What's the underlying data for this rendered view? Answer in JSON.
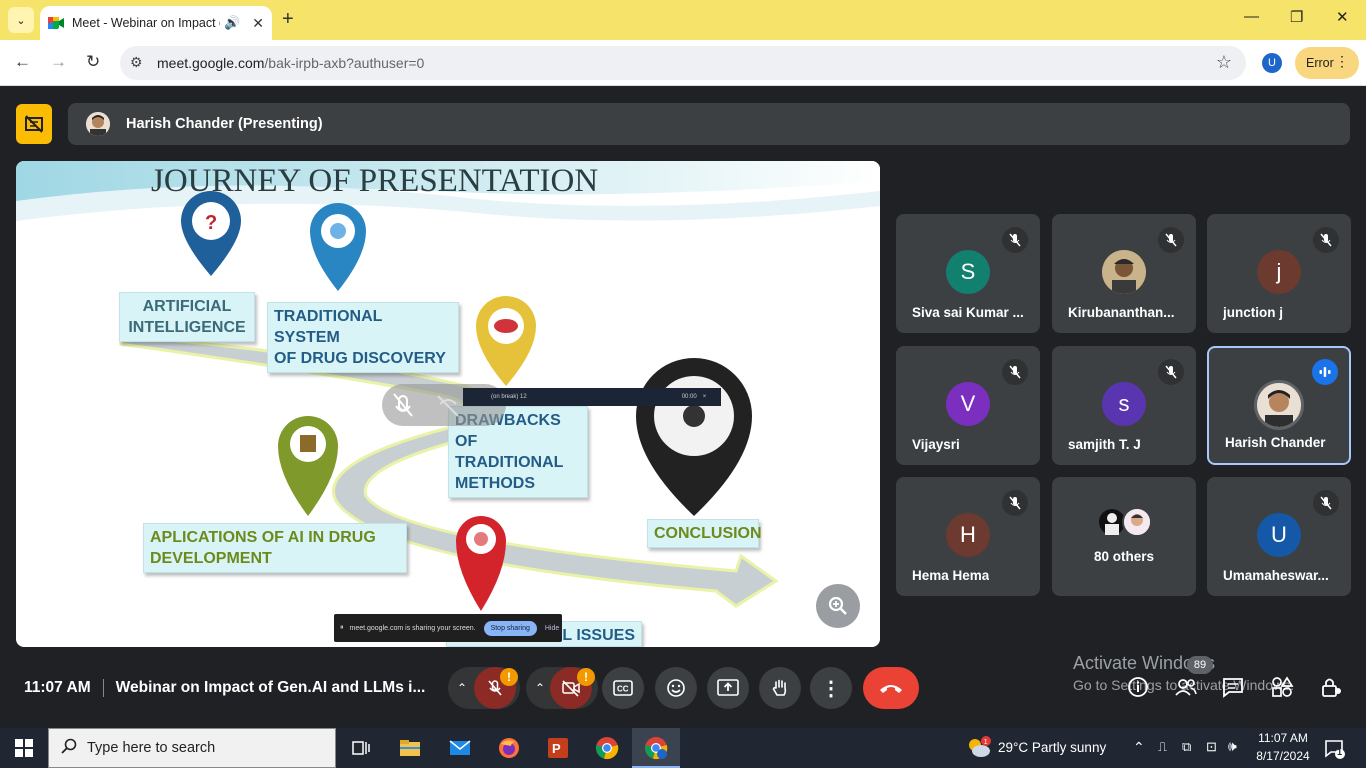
{
  "browser": {
    "tab_title": "Meet - Webinar on Impact of Gen.AI and LLMs",
    "url_host": "meet.google.com",
    "url_path": "/bak-irpb-axb?authuser=0",
    "profile_initial": "U",
    "error_label": "Error"
  },
  "meet": {
    "presenting_label": "Harish Chander (Presenting)",
    "time": "11:07 AM",
    "meeting_title": "Webinar on Impact of Gen.AI and LLMs i...",
    "participant_count": "89",
    "others_label": "80 others"
  },
  "slide": {
    "title": "JOURNEY OF PRESENTATION",
    "labels": {
      "ai": "ARTIFICIAL\nINTELLIGENCE",
      "tds": "TRADITIONAL SYSTEM\nOF DRUG DISCOVERY",
      "drawbacks": "DRAWBACKS OF\nTRADITIONAL\nMETHODS",
      "applications": "APLICATIONS OF AI IN DRUG\nDEVELOPMENT",
      "conclusion": "CONCLUSION",
      "ethical": "ETHICAL ISSUES"
    },
    "share_notice": "meet.google.com is sharing your screen.",
    "stop_sharing": "Stop sharing",
    "hide": "Hide",
    "timer_label": "(on break) 12",
    "timer_value": "00:00"
  },
  "participants": [
    {
      "name": "Siva sai Kumar ...",
      "initial": "S",
      "color": "#12806e"
    },
    {
      "name": "Kirubananthan...",
      "initial": "",
      "color": "#8a7a5a"
    },
    {
      "name": "junction j",
      "initial": "j",
      "color": "#6d3a2f"
    },
    {
      "name": "Vijaysri",
      "initial": "V",
      "color": "#7b2fbf"
    },
    {
      "name": "samjith T. J",
      "initial": "s",
      "color": "#5a35b0"
    },
    {
      "name": "Harish Chander",
      "initial": "",
      "color": "#d8b08a"
    },
    {
      "name": "Hema Hema",
      "initial": "H",
      "color": "#6d3a2f"
    },
    {
      "name": "Umamaheswar...",
      "initial": "U",
      "color": "#1558a8"
    }
  ],
  "watermark": {
    "line1": "Activate Windows",
    "line2": "Go to Settings to activate Windows."
  },
  "taskbar": {
    "search_placeholder": "Type here to search",
    "weather": "29°C  Partly sunny",
    "time": "11:07 AM",
    "date": "8/17/2024",
    "notif_count": "1"
  }
}
